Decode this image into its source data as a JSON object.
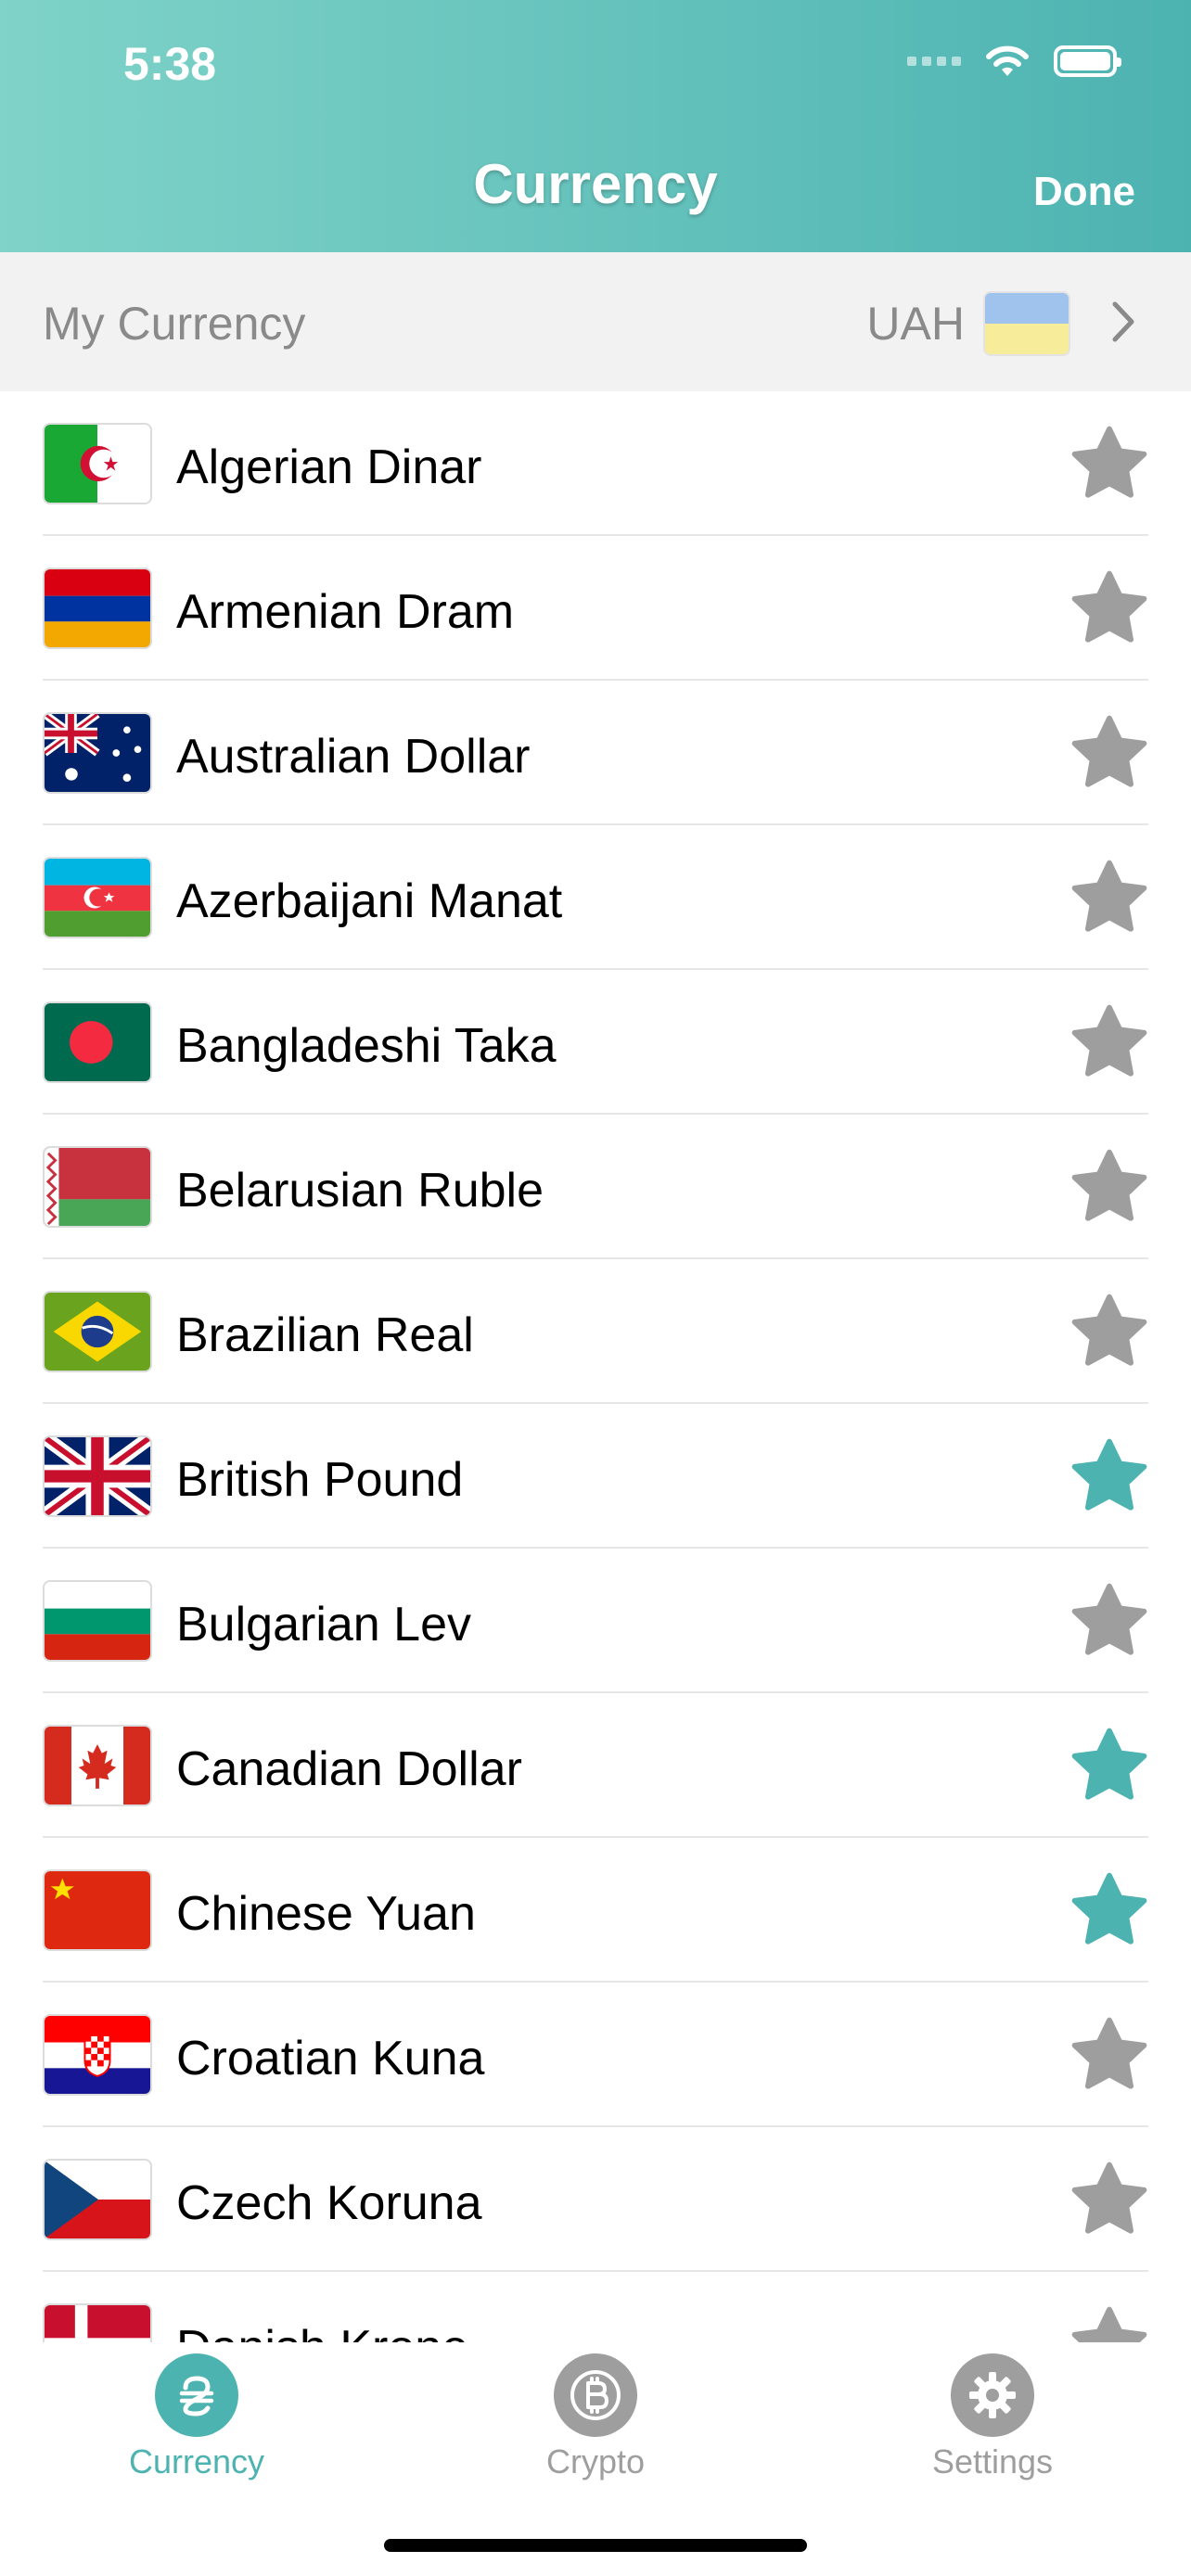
{
  "status_bar": {
    "time": "5:38"
  },
  "nav": {
    "title": "Currency",
    "done_label": "Done"
  },
  "my_currency": {
    "label": "My Currency",
    "code": "UAH"
  },
  "colors": {
    "accent": "#4db3b1",
    "star_inactive": "#9e9e9e",
    "header_start": "#7fd3c8",
    "header_end": "#4db3b1"
  },
  "currencies": [
    {
      "name": "Algerian Dinar",
      "flag": "algeria-flag",
      "favorite": false
    },
    {
      "name": "Armenian Dram",
      "flag": "armenia-flag",
      "favorite": false
    },
    {
      "name": "Australian Dollar",
      "flag": "australia-flag",
      "favorite": false
    },
    {
      "name": "Azerbaijani Manat",
      "flag": "azerbaijan-flag",
      "favorite": false
    },
    {
      "name": "Bangladeshi Taka",
      "flag": "bangladesh-flag",
      "favorite": false
    },
    {
      "name": "Belarusian Ruble",
      "flag": "belarus-flag",
      "favorite": false
    },
    {
      "name": "Brazilian Real",
      "flag": "brazil-flag",
      "favorite": false
    },
    {
      "name": "British Pound",
      "flag": "uk-flag",
      "favorite": true
    },
    {
      "name": "Bulgarian Lev",
      "flag": "bulgaria-flag",
      "favorite": false
    },
    {
      "name": "Canadian Dollar",
      "flag": "canada-flag",
      "favorite": true
    },
    {
      "name": "Chinese Yuan",
      "flag": "china-flag",
      "favorite": true
    },
    {
      "name": "Croatian Kuna",
      "flag": "croatia-flag",
      "favorite": false
    },
    {
      "name": "Czech Koruna",
      "flag": "czech-flag",
      "favorite": false
    },
    {
      "name": "Danish Krone",
      "flag": "denmark-flag",
      "favorite": false
    }
  ],
  "tabs": [
    {
      "label": "Currency",
      "icon": "hryvnia-icon",
      "active": true
    },
    {
      "label": "Crypto",
      "icon": "bitcoin-icon",
      "active": false
    },
    {
      "label": "Settings",
      "icon": "gear-icon",
      "active": false
    }
  ]
}
